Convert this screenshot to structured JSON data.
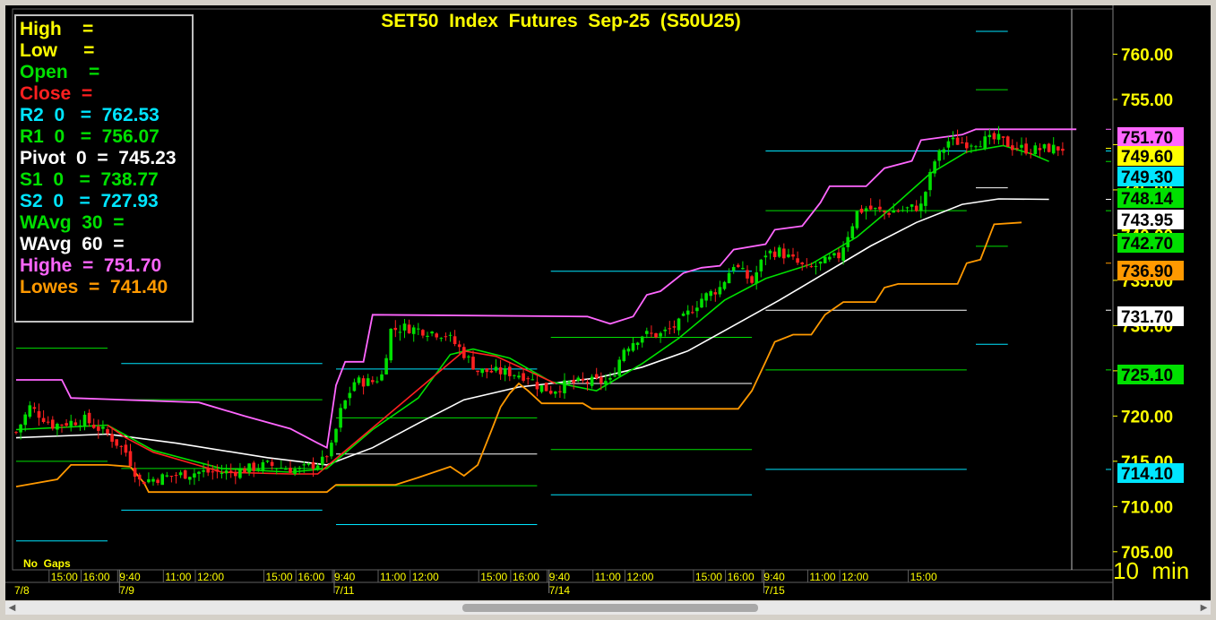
{
  "colors": {
    "high": "#ffff00",
    "low": "#ffff00",
    "open": "#00e000",
    "close": "#ff2020",
    "r2": "#00e5ff",
    "r1": "#00e000",
    "pivot": "#ffffff",
    "s1": "#00e000",
    "s2": "#00e5ff",
    "wavg30": "#00e000",
    "wavg60": "#ffffff",
    "highest": "#ff66ff",
    "lowest": "#ff9900",
    "up_candle": "#00e000",
    "down_candle": "#ff2020",
    "title": "#ffff00"
  },
  "legend": {
    "rows": [
      {
        "label": "High    =",
        "color": "#ffff00"
      },
      {
        "label": "Low     =",
        "color": "#ffff00"
      },
      {
        "label": "Open    =",
        "color": "#00e000"
      },
      {
        "label": "Close  =",
        "color": "#ff2020"
      },
      {
        "label": "R2  0   =  762.53",
        "color": "#00e5ff"
      },
      {
        "label": "R1  0   =  756.07",
        "color": "#00e000"
      },
      {
        "label": "Pivot  0  =  745.23",
        "color": "#ffffff"
      },
      {
        "label": "S1  0   =  738.77",
        "color": "#00e000"
      },
      {
        "label": "S2  0   =  727.93",
        "color": "#00e5ff"
      },
      {
        "label": "WAvg  30  =",
        "color": "#00e000"
      },
      {
        "label": "WAvg  60  =",
        "color": "#ffffff"
      },
      {
        "label": "Highe  =  751.70",
        "color": "#ff66ff"
      },
      {
        "label": "Lowes  =  741.40",
        "color": "#ff9900"
      }
    ]
  },
  "chart_data": {
    "type": "candlestick",
    "title": "SET50  Index  Futures  Sep-25  (S50U25)",
    "interval_label": "10  min",
    "gaps_label": "No  Gaps",
    "ylim": [
      703,
      765
    ],
    "y_ticks": [
      "760.00",
      "755.00",
      "750.00",
      "745.00",
      "740.00",
      "735.00",
      "730.00",
      "725.00",
      "720.00",
      "715.00",
      "710.00",
      "705.00"
    ],
    "y_tick_values": [
      760,
      755,
      750,
      745,
      740,
      735,
      730,
      725,
      720,
      715,
      710,
      705
    ],
    "price_tags": [
      {
        "text": "751.70",
        "value": 751.7,
        "bg": "#ff66ff",
        "fg": "#000000"
      },
      {
        "text": "749.60",
        "value": 749.6,
        "bg": "#ffff00",
        "fg": "#000000"
      },
      {
        "text": "749.30",
        "value": 749.3,
        "bg": "#00e5ff",
        "fg": "#000000"
      },
      {
        "text": "748.14",
        "value": 748.14,
        "bg": "#00e000",
        "fg": "#000000"
      },
      {
        "text": "743.95",
        "value": 743.95,
        "bg": "#ffffff",
        "fg": "#000000"
      },
      {
        "text": "742.70",
        "value": 742.7,
        "bg": "#00e000",
        "fg": "#000000"
      },
      {
        "text": "736.90",
        "value": 736.9,
        "bg": "#ff9900",
        "fg": "#000000"
      },
      {
        "text": "731.70",
        "value": 731.7,
        "bg": "#ffffff",
        "fg": "#000000"
      },
      {
        "text": "725.10",
        "value": 725.1,
        "bg": "#00e000",
        "fg": "#000000"
      },
      {
        "text": "714.10",
        "value": 714.1,
        "bg": "#00e5ff",
        "fg": "#000000"
      }
    ],
    "bar_count": 230,
    "session_starts": [
      0,
      23,
      70,
      117,
      164
    ],
    "time_labels": [
      {
        "i": 8,
        "text": "15:00"
      },
      {
        "i": 15,
        "text": "16:00"
      },
      {
        "i": 23,
        "text": "9:40"
      },
      {
        "i": 33,
        "text": "11:00"
      },
      {
        "i": 40,
        "text": "12:00"
      },
      {
        "i": 55,
        "text": "15:00"
      },
      {
        "i": 62,
        "text": "16:00"
      },
      {
        "i": 70,
        "text": "9:40"
      },
      {
        "i": 80,
        "text": "11:00"
      },
      {
        "i": 87,
        "text": "12:00"
      },
      {
        "i": 102,
        "text": "15:00"
      },
      {
        "i": 109,
        "text": "16:00"
      },
      {
        "i": 117,
        "text": "9:40"
      },
      {
        "i": 127,
        "text": "11:00"
      },
      {
        "i": 134,
        "text": "12:00"
      },
      {
        "i": 149,
        "text": "15:00"
      },
      {
        "i": 156,
        "text": "16:00"
      },
      {
        "i": 164,
        "text": "9:40"
      },
      {
        "i": 174,
        "text": "11:00"
      },
      {
        "i": 181,
        "text": "12:00"
      },
      {
        "i": 196,
        "text": "15:00"
      }
    ],
    "date_labels": [
      {
        "i": 0,
        "text": "7/8"
      },
      {
        "i": 23,
        "text": "7/9"
      },
      {
        "i": 70,
        "text": "7/11"
      },
      {
        "i": 117,
        "text": "7/14"
      },
      {
        "i": 164,
        "text": "7/15"
      }
    ],
    "pivot_sessions": [
      {
        "start": 0,
        "end": 20,
        "r2": 0,
        "r1": 727.5,
        "pivot": 0,
        "s1": 715.0,
        "s2": 706.2
      },
      {
        "start": 23,
        "end": 67,
        "r2": 725.8,
        "r1": 721.8,
        "pivot": 0,
        "s1": 714.2,
        "s2": 709.6
      },
      {
        "start": 70,
        "end": 114,
        "r2": 725.2,
        "r1": 719.8,
        "pivot": 715.8,
        "s1": 712.3,
        "s2": 708.0
      },
      {
        "start": 117,
        "end": 161,
        "r2": 736.0,
        "r1": 728.7,
        "pivot": 723.6,
        "s1": 716.3,
        "s2": 711.3
      },
      {
        "start": 164,
        "end": 208,
        "r2": 749.3,
        "r1": 742.7,
        "pivot": 731.7,
        "s1": 725.1,
        "s2": 714.1
      },
      {
        "start": 210,
        "end": 217,
        "r2": 762.53,
        "r1": 756.07,
        "pivot": 745.23,
        "s1": 738.77,
        "s2": 727.93
      }
    ],
    "price_path": [
      [
        0,
        718.2
      ],
      [
        3,
        721.0
      ],
      [
        8,
        719.0
      ],
      [
        15,
        719.6
      ],
      [
        20,
        718.0
      ],
      [
        24,
        716.0
      ],
      [
        27,
        712.8
      ],
      [
        33,
        713.3
      ],
      [
        40,
        713.8
      ],
      [
        47,
        713.8
      ],
      [
        55,
        714.6
      ],
      [
        62,
        714.0
      ],
      [
        67,
        715.0
      ],
      [
        69,
        716.5
      ],
      [
        71,
        720.5
      ],
      [
        74,
        723.8
      ],
      [
        78,
        723.8
      ],
      [
        80,
        724.5
      ],
      [
        82,
        729.5
      ],
      [
        85,
        729.8
      ],
      [
        90,
        729.4
      ],
      [
        94,
        729.0
      ],
      [
        97,
        727.5
      ],
      [
        101,
        725.0
      ],
      [
        108,
        724.8
      ],
      [
        112,
        724.4
      ],
      [
        114,
        723.4
      ],
      [
        117,
        722.8
      ],
      [
        121,
        723.6
      ],
      [
        126,
        723.8
      ],
      [
        130,
        723.8
      ],
      [
        133,
        727.5
      ],
      [
        137,
        729.0
      ],
      [
        141,
        729.0
      ],
      [
        145,
        730.2
      ],
      [
        150,
        733.0
      ],
      [
        154,
        734.2
      ],
      [
        157,
        736.8
      ],
      [
        161,
        734.8
      ],
      [
        164,
        738.0
      ],
      [
        167,
        738.2
      ],
      [
        170,
        737.2
      ],
      [
        173,
        736.2
      ],
      [
        176,
        736.8
      ],
      [
        180,
        737.7
      ],
      [
        184,
        742.5
      ],
      [
        186,
        743.0
      ],
      [
        190,
        742.5
      ],
      [
        194,
        742.8
      ],
      [
        198,
        743.2
      ],
      [
        201,
        748.2
      ],
      [
        204,
        750.4
      ],
      [
        208,
        750.2
      ],
      [
        211,
        750.4
      ],
      [
        215,
        750.6
      ],
      [
        218,
        749.8
      ],
      [
        222,
        749.4
      ],
      [
        226,
        749.6
      ],
      [
        229,
        749.6
      ]
    ],
    "highest_path": [
      [
        0,
        724.0
      ],
      [
        10,
        724.0
      ],
      [
        12,
        722.0
      ],
      [
        40,
        721.5
      ],
      [
        50,
        720.0
      ],
      [
        60,
        718.6
      ],
      [
        66,
        717.0
      ],
      [
        68,
        716.5
      ],
      [
        70,
        723.4
      ],
      [
        72,
        726.0
      ],
      [
        76,
        726.0
      ],
      [
        78,
        731.2
      ],
      [
        125,
        731.0
      ],
      [
        130,
        730.2
      ],
      [
        135,
        731.0
      ],
      [
        138,
        733.4
      ],
      [
        141,
        733.8
      ],
      [
        146,
        735.8
      ],
      [
        150,
        736.4
      ],
      [
        154,
        736.6
      ],
      [
        157,
        738.4
      ],
      [
        164,
        739.0
      ],
      [
        166,
        740.6
      ],
      [
        172,
        741.0
      ],
      [
        176,
        743.6
      ],
      [
        178,
        745.4
      ],
      [
        186,
        745.4
      ],
      [
        190,
        747.4
      ],
      [
        196,
        748.2
      ],
      [
        198,
        750.5
      ],
      [
        207,
        751.1
      ],
      [
        210,
        751.7
      ],
      [
        232,
        751.7
      ]
    ],
    "lowest_path": [
      [
        0,
        712.2
      ],
      [
        9,
        713.0
      ],
      [
        12,
        714.6
      ],
      [
        20,
        714.6
      ],
      [
        25,
        714.4
      ],
      [
        28,
        712.6
      ],
      [
        29,
        711.6
      ],
      [
        68,
        711.6
      ],
      [
        70,
        712.4
      ],
      [
        83,
        712.4
      ],
      [
        88,
        713.2
      ],
      [
        95,
        714.4
      ],
      [
        98,
        713.4
      ],
      [
        101,
        714.6
      ],
      [
        104,
        718.4
      ],
      [
        106,
        721.0
      ],
      [
        108,
        722.5
      ],
      [
        110,
        723.6
      ],
      [
        112,
        722.8
      ],
      [
        115,
        721.4
      ],
      [
        124,
        721.4
      ],
      [
        126,
        720.8
      ],
      [
        158,
        720.8
      ],
      [
        161,
        722.8
      ],
      [
        164,
        726.0
      ],
      [
        166,
        728.2
      ],
      [
        170,
        729.0
      ],
      [
        174,
        729.0
      ],
      [
        177,
        731.2
      ],
      [
        181,
        732.6
      ],
      [
        188,
        732.6
      ],
      [
        190,
        734.2
      ],
      [
        193,
        734.6
      ],
      [
        206,
        734.6
      ],
      [
        208,
        736.9
      ],
      [
        211,
        737.3
      ],
      [
        214,
        741.2
      ],
      [
        220,
        741.4
      ]
    ],
    "wavg30_path": [
      [
        0,
        718.5
      ],
      [
        20,
        719.0
      ],
      [
        30,
        716.2
      ],
      [
        45,
        714.2
      ],
      [
        60,
        713.8
      ],
      [
        68,
        714.2
      ],
      [
        78,
        718.5
      ],
      [
        88,
        722.0
      ],
      [
        95,
        726.8
      ],
      [
        100,
        727.4
      ],
      [
        108,
        726.4
      ],
      [
        117,
        723.8
      ],
      [
        127,
        722.8
      ],
      [
        137,
        725.8
      ],
      [
        145,
        728.6
      ],
      [
        155,
        732.8
      ],
      [
        164,
        735.2
      ],
      [
        174,
        736.8
      ],
      [
        184,
        739.8
      ],
      [
        192,
        743.2
      ],
      [
        200,
        746.8
      ],
      [
        208,
        749.2
      ],
      [
        216,
        749.9
      ],
      [
        222,
        749.0
      ],
      [
        226,
        748.14
      ]
    ],
    "wavg60_path": [
      [
        0,
        717.6
      ],
      [
        20,
        718.0
      ],
      [
        35,
        717.0
      ],
      [
        55,
        715.4
      ],
      [
        68,
        714.6
      ],
      [
        78,
        716.5
      ],
      [
        88,
        719.2
      ],
      [
        98,
        721.8
      ],
      [
        110,
        723.2
      ],
      [
        117,
        723.6
      ],
      [
        127,
        724.2
      ],
      [
        137,
        725.4
      ],
      [
        147,
        727.2
      ],
      [
        157,
        730.0
      ],
      [
        167,
        732.8
      ],
      [
        177,
        735.8
      ],
      [
        187,
        738.8
      ],
      [
        197,
        741.4
      ],
      [
        207,
        743.4
      ],
      [
        215,
        744.0
      ],
      [
        226,
        743.95
      ]
    ],
    "red_avg_path": [
      [
        20,
        719.0
      ],
      [
        24,
        717.6
      ],
      [
        30,
        716.0
      ],
      [
        45,
        713.8
      ],
      [
        60,
        713.6
      ],
      [
        66,
        713.6
      ],
      [
        98,
        727.2
      ],
      [
        105,
        726.6
      ],
      [
        112,
        725.0
      ],
      [
        118,
        723.6
      ]
    ]
  }
}
